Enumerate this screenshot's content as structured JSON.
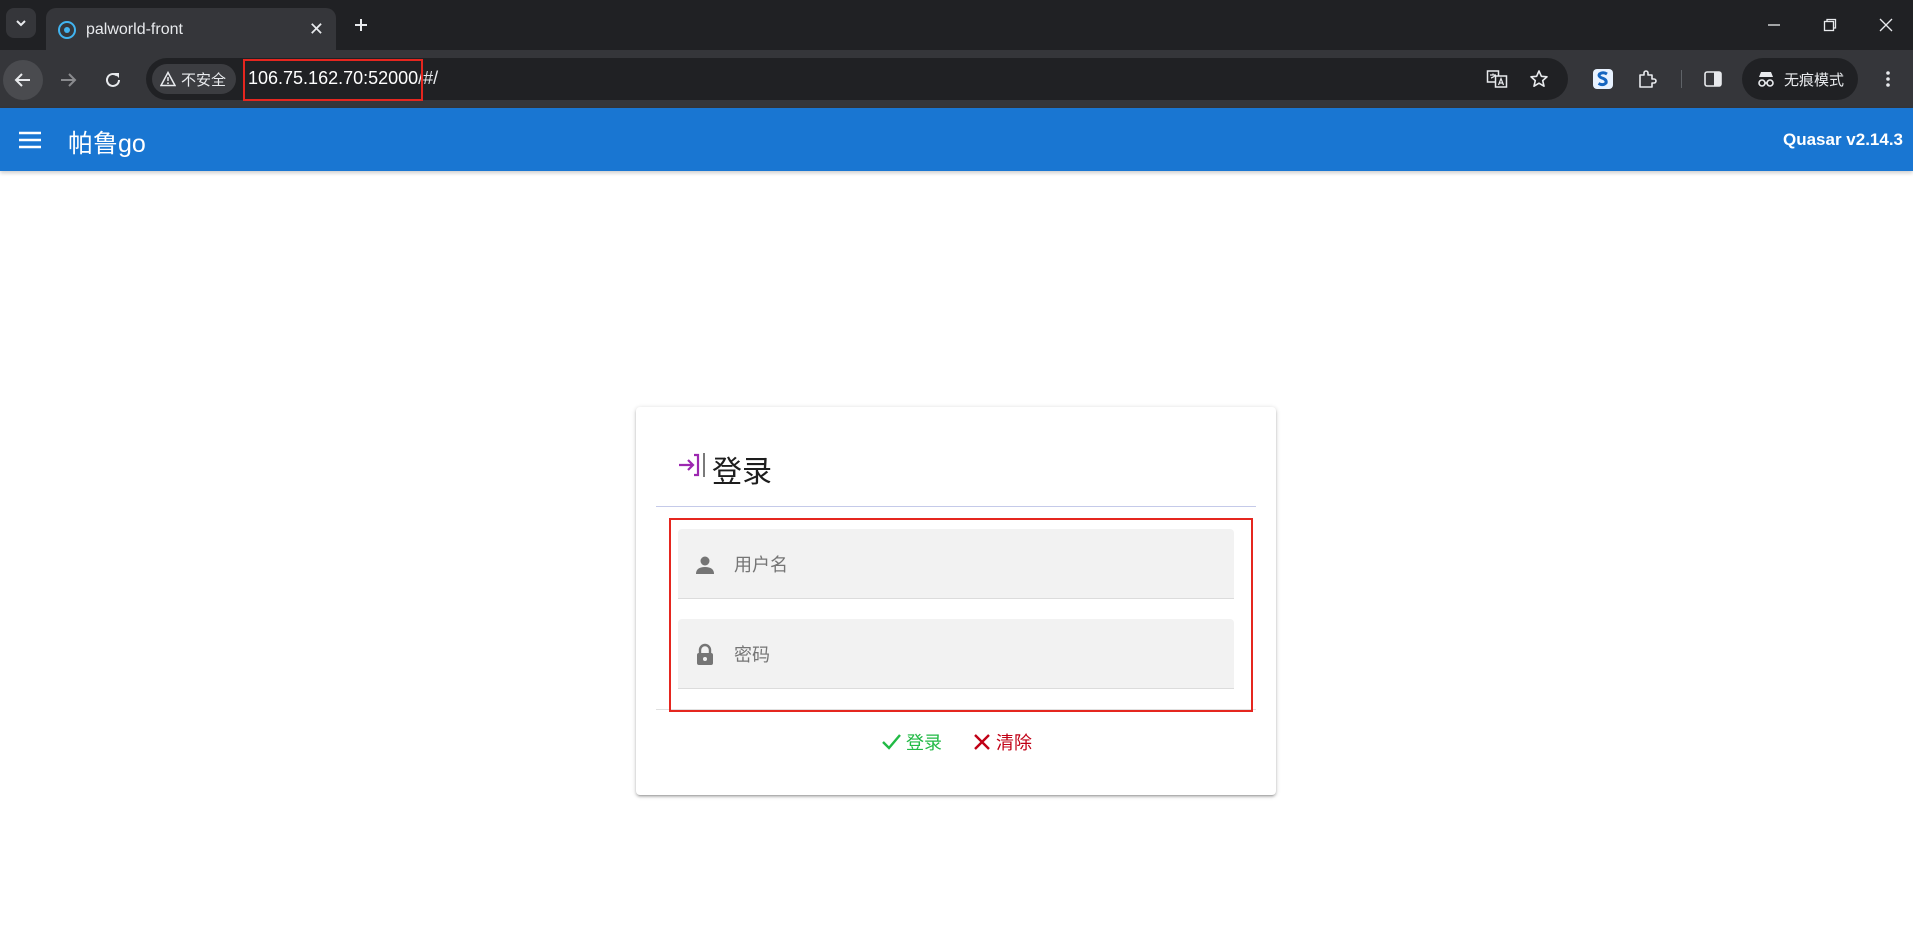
{
  "browser": {
    "tab_title": "palworld-front",
    "security_label": "不安全",
    "url_host": "106.75.162.70:52000",
    "url_rest": "/#/",
    "incognito_label": "无痕模式"
  },
  "app": {
    "title": "帕鲁go",
    "version": "Quasar v2.14.3"
  },
  "login": {
    "title": "登录",
    "username_placeholder": "用户名",
    "password_placeholder": "密码",
    "login_label": "登录",
    "clear_label": "清除"
  },
  "colors": {
    "header": "#1976d2",
    "positive": "#21ba45",
    "negative": "#c10015",
    "title_icon": "#9c27b0",
    "highlight": "#e5261f"
  },
  "icons": {
    "title_icon": "login-icon",
    "username_icon": "person-icon",
    "password_icon": "lock-icon"
  }
}
